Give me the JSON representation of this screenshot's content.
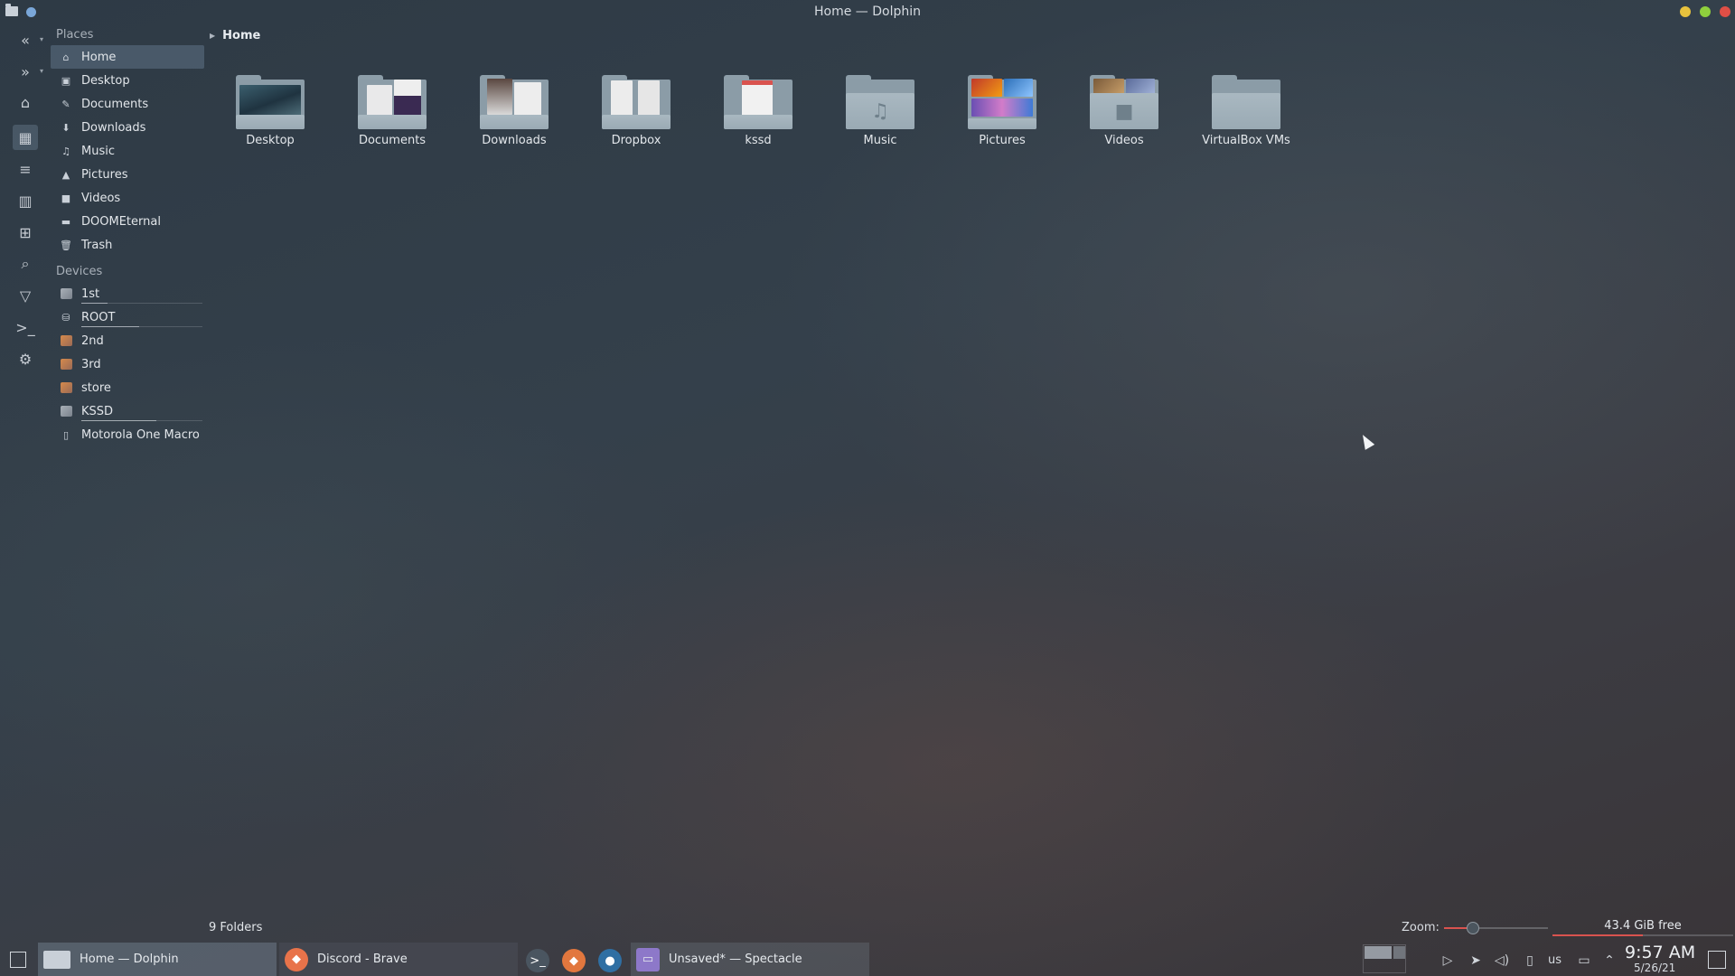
{
  "window": {
    "title": "Home — Dolphin"
  },
  "toolbar": {
    "buttons": [
      {
        "name": "back-button",
        "icon": "back-icon"
      },
      {
        "name": "forward-button",
        "icon": "forward-icon"
      },
      {
        "name": "home-button",
        "icon": "home-icon"
      },
      {
        "name": "icons-view-button",
        "icon": "icons-view-icon"
      },
      {
        "name": "details-view-button",
        "icon": "details-view-icon"
      },
      {
        "name": "split-button",
        "icon": "split-icon"
      },
      {
        "name": "new-tab-button",
        "icon": "new-tab-icon"
      },
      {
        "name": "search-button",
        "icon": "search-icon"
      },
      {
        "name": "filter-button",
        "icon": "filter-icon"
      },
      {
        "name": "terminal-button",
        "icon": "terminal-icon"
      },
      {
        "name": "settings-button",
        "icon": "gear-icon"
      }
    ]
  },
  "places": {
    "title": "Places",
    "items": [
      {
        "label": "Home",
        "icon": "home-icon",
        "selected": true
      },
      {
        "label": "Desktop",
        "icon": "desktop-icon"
      },
      {
        "label": "Documents",
        "icon": "documents-icon"
      },
      {
        "label": "Downloads",
        "icon": "downloads-icon"
      },
      {
        "label": "Music",
        "icon": "music-icon"
      },
      {
        "label": "Pictures",
        "icon": "pictures-icon"
      },
      {
        "label": "Videos",
        "icon": "videos-icon"
      },
      {
        "label": "DOOMEternal",
        "icon": "folder-icon"
      },
      {
        "label": "Trash",
        "icon": "trash-icon"
      }
    ]
  },
  "devices": {
    "title": "Devices",
    "items": [
      {
        "label": "1st",
        "icon": "drive-icon",
        "usage": 0.22
      },
      {
        "label": "ROOT",
        "icon": "drive-icon",
        "usage": 0.48
      },
      {
        "label": "2nd",
        "icon": "drive-icon"
      },
      {
        "label": "3rd",
        "icon": "drive-icon"
      },
      {
        "label": "store",
        "icon": "drive-icon"
      },
      {
        "label": "KSSD",
        "icon": "drive-icon",
        "usage": 0.62
      },
      {
        "label": "Motorola One Macro",
        "icon": "phone-icon"
      }
    ]
  },
  "breadcrumb": {
    "current": "Home"
  },
  "folders": [
    {
      "label": "Desktop",
      "icon": "folder-desktop-icon"
    },
    {
      "label": "Documents",
      "icon": "folder-documents-icon"
    },
    {
      "label": "Downloads",
      "icon": "folder-downloads-icon"
    },
    {
      "label": "Dropbox",
      "icon": "folder-dropbox-icon"
    },
    {
      "label": "kssd",
      "icon": "folder-kssd-icon"
    },
    {
      "label": "Music",
      "icon": "folder-music-icon"
    },
    {
      "label": "Pictures",
      "icon": "folder-pictures-icon"
    },
    {
      "label": "Videos",
      "icon": "folder-videos-icon"
    },
    {
      "label": "VirtualBox VMs",
      "icon": "folder-icon"
    }
  ],
  "status": {
    "folders_count": "9 Folders",
    "zoom_label": "Zoom:",
    "zoom_level": 0.28,
    "free_space": "43.4 GiB free",
    "free_space_used": 0.5
  },
  "taskbar": {
    "tasks": [
      {
        "label": "Home — Dolphin",
        "icon": "dolphin-icon",
        "active": true
      },
      {
        "label": "Discord - Brave",
        "icon": "brave-icon"
      },
      {
        "label": "Unsaved* — Spectacle",
        "icon": "spectacle-icon"
      }
    ],
    "launchers": [
      {
        "name": "terminal-launcher",
        "icon": "terminal-icon"
      },
      {
        "name": "gitlab-launcher",
        "icon": "fox-icon"
      },
      {
        "name": "steam-launcher",
        "icon": "steam-icon"
      }
    ],
    "keyboard_layout": "us",
    "clock_time": "9:57 AM",
    "clock_date": "5/26/21"
  },
  "colors": {
    "accent_red": "#d9534f",
    "selection": "#5f7387",
    "minimize": "#e8c23d",
    "maximize": "#8fcf3d",
    "close": "#e04f46"
  }
}
